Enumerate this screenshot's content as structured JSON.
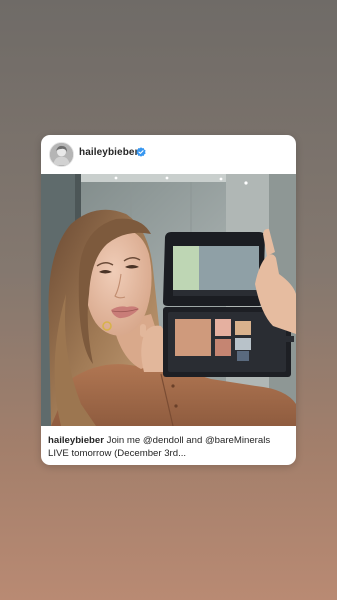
{
  "post": {
    "username": "haileybieber",
    "verified": true,
    "caption_user": "haileybieber",
    "caption_text": " Join me @dendoll and @bareMinerals LIVE tomorrow (December 3rd..."
  },
  "colors": {
    "background_top": "#6f6b67",
    "background_bottom": "#b98a73",
    "verified_blue": "#3897f0",
    "text": "#262626"
  },
  "icons": {
    "avatar": "profile-photo",
    "verified": "verified-badge-icon"
  }
}
